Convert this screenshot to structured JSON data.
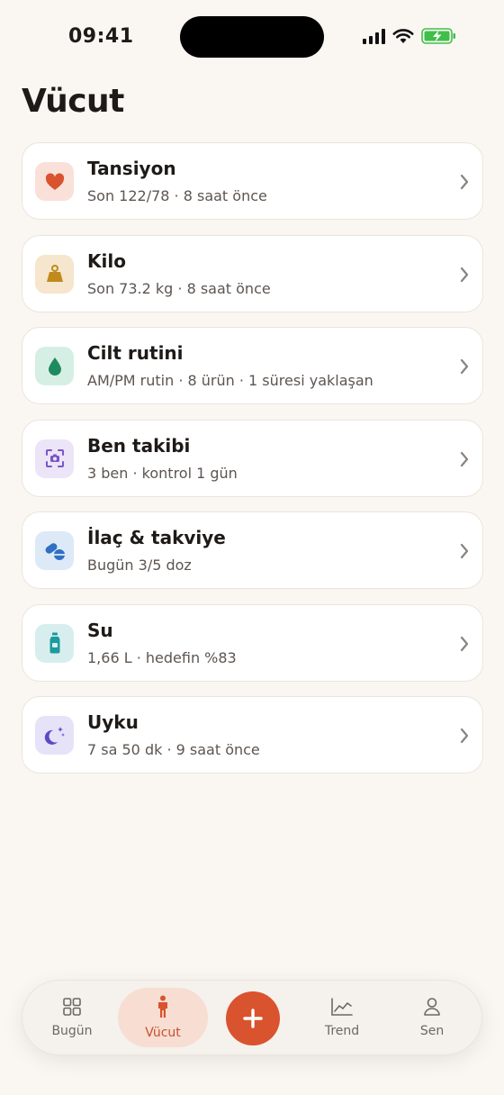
{
  "status_bar": {
    "time": "09:41"
  },
  "page": {
    "title": "Vücut"
  },
  "items": [
    {
      "title": "Tansiyon",
      "subtitle": "Son 122/78 · 8 saat önce",
      "icon": "heart-icon",
      "icon_bg": "#f9e1da",
      "icon_color": "#d9532e"
    },
    {
      "title": "Kilo",
      "subtitle": "Son 73.2 kg · 8 saat önce",
      "icon": "weight-icon",
      "icon_bg": "#f5e6cd",
      "icon_color": "#c08a1c"
    },
    {
      "title": "Cilt rutini",
      "subtitle": "AM/PM rutin · 8 ürün · 1 süresi yaklaşan",
      "icon": "drop-icon",
      "icon_bg": "#d6efe5",
      "icon_color": "#1f8a5e"
    },
    {
      "title": "Ben takibi",
      "subtitle": "3 ben · kontrol 1 gün",
      "icon": "camera-scan-icon",
      "icon_bg": "#ece4f7",
      "icon_color": "#7b55c7"
    },
    {
      "title": "İlaç & takviye",
      "subtitle": "Bugün 3/5 doz",
      "icon": "pills-icon",
      "icon_bg": "#dde9f7",
      "icon_color": "#2f6fc4"
    },
    {
      "title": "Su",
      "subtitle": "1,66 L · hedefin %83",
      "icon": "water-bottle-icon",
      "icon_bg": "#d8eeee",
      "icon_color": "#1c9a9e"
    },
    {
      "title": "Uyku",
      "subtitle": "7 sa 50 dk · 9 saat önce",
      "icon": "moon-stars-icon",
      "icon_bg": "#e6e2f7",
      "icon_color": "#5a49c4"
    }
  ],
  "tab_bar": {
    "tabs": [
      {
        "label": "Bugün",
        "icon": "grid-icon",
        "active": false
      },
      {
        "label": "Vücut",
        "icon": "body-icon",
        "active": true
      },
      {
        "label": "Trend",
        "icon": "chart-icon",
        "active": false
      },
      {
        "label": "Sen",
        "icon": "person-icon",
        "active": false
      }
    ],
    "add_icon": "plus-icon"
  },
  "colors": {
    "background": "#faf7f3",
    "accent": "#d9532e",
    "active_tab_bg": "#f7ddd2"
  }
}
